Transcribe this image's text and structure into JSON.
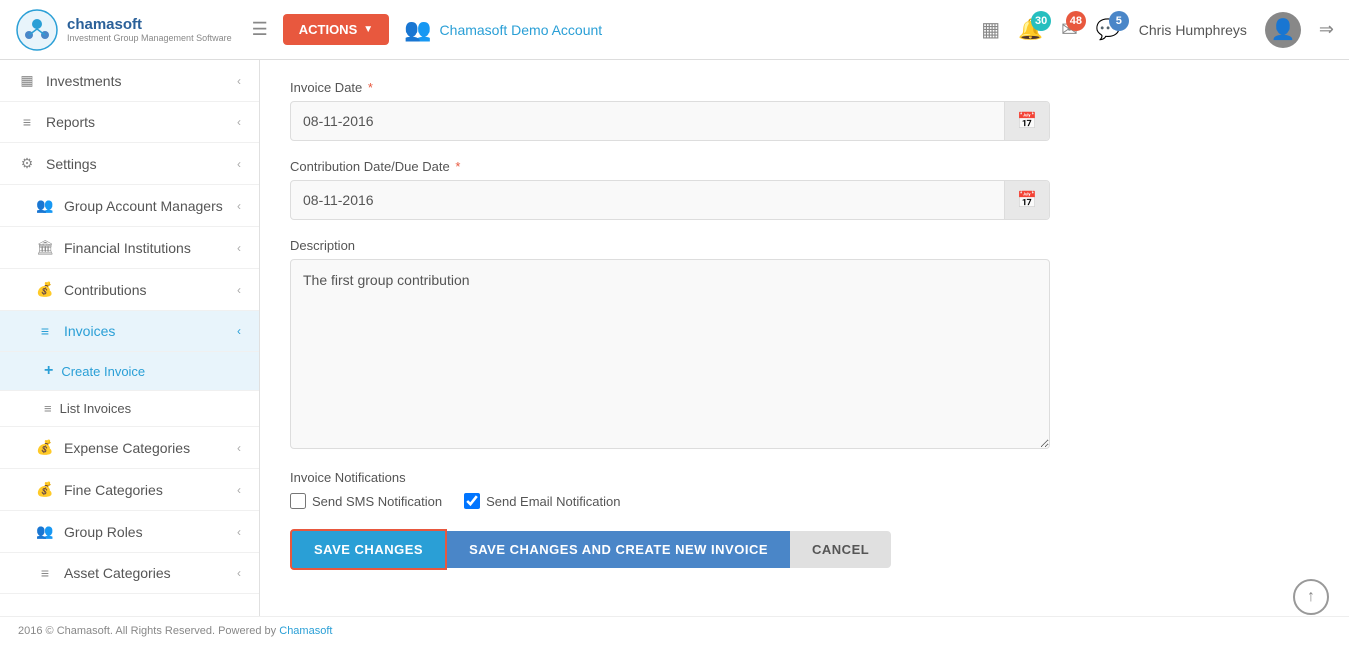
{
  "app": {
    "name": "chamasoft",
    "tagline": "Investment Group Management Software"
  },
  "navbar": {
    "actions_label": "ACTIONS",
    "account_name": "Chamasoft Demo Account",
    "bell_count": "30",
    "mail_count": "48",
    "msg_count": "5",
    "user_name": "Chris Humphreys"
  },
  "sidebar": {
    "items": [
      {
        "id": "investments",
        "label": "Investments",
        "icon": "▦",
        "has_chevron": true
      },
      {
        "id": "reports",
        "label": "Reports",
        "icon": "≡",
        "has_chevron": true
      },
      {
        "id": "settings",
        "label": "Settings",
        "icon": "⚙",
        "has_chevron": true
      },
      {
        "id": "group-account-managers",
        "label": "Group Account Managers",
        "icon": "👥",
        "has_chevron": true,
        "indent": true
      },
      {
        "id": "financial-institutions",
        "label": "Financial Institutions",
        "icon": "🏛",
        "has_chevron": true,
        "indent": true
      },
      {
        "id": "contributions",
        "label": "Contributions",
        "icon": "💰",
        "has_chevron": true,
        "indent": true
      },
      {
        "id": "invoices",
        "label": "Invoices",
        "icon": "≡",
        "has_chevron": true,
        "indent": true,
        "active": true
      },
      {
        "id": "expense-categories",
        "label": "Expense Categories",
        "icon": "💰",
        "has_chevron": true,
        "indent": true
      },
      {
        "id": "fine-categories",
        "label": "Fine Categories",
        "icon": "💰",
        "has_chevron": true,
        "indent": true
      },
      {
        "id": "group-roles",
        "label": "Group Roles",
        "icon": "👥",
        "has_chevron": true,
        "indent": true
      },
      {
        "id": "asset-categories",
        "label": "Asset Categories",
        "icon": "≡",
        "has_chevron": true,
        "indent": true
      }
    ],
    "sub_items": [
      {
        "id": "create-invoice",
        "label": "Create Invoice",
        "icon": "+",
        "active": true
      },
      {
        "id": "list-invoices",
        "label": "List Invoices",
        "icon": "≡"
      }
    ]
  },
  "form": {
    "invoice_date_label": "Invoice Date",
    "invoice_date_value": "08-11-2016",
    "contribution_date_label": "Contribution Date/Due Date",
    "contribution_date_value": "08-11-2016",
    "description_label": "Description",
    "description_value": "The first group contribution",
    "notifications_label": "Invoice Notifications",
    "sms_label": "Send SMS Notification",
    "email_label": "Send Email Notification",
    "sms_checked": false,
    "email_checked": true
  },
  "buttons": {
    "save_label": "SAVE CHANGES",
    "save_new_label": "SAVE CHANGES AND CREATE NEW INVOICE",
    "cancel_label": "CANCEL"
  },
  "footer": {
    "text": "2016 © Chamasoft. All Rights Reserved. Powered by",
    "link_text": "Chamasoft"
  }
}
